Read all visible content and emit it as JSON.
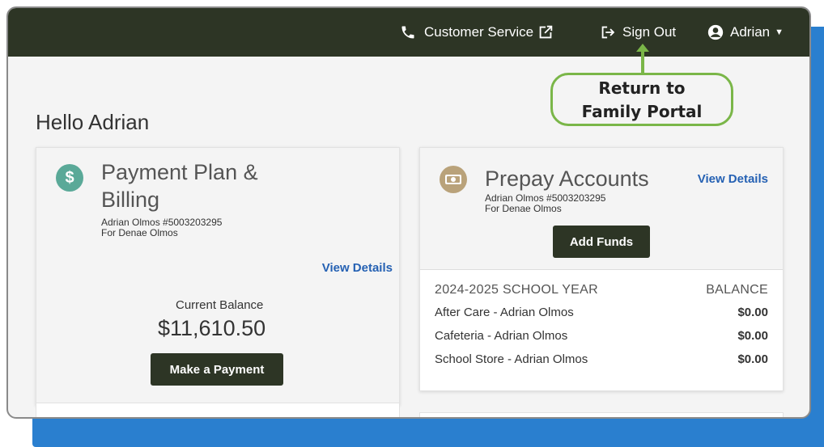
{
  "header": {
    "customer_service": "Customer Service",
    "sign_out": "Sign Out",
    "user": "Adrian"
  },
  "callout": {
    "line1": "Return to",
    "line2": "Family Portal"
  },
  "greeting": "Hello Adrian",
  "payment_card": {
    "icon_symbol": "$",
    "title_line1": "Payment Plan &",
    "title_line2": "Billing",
    "account": "Adrian Olmos #5003203295",
    "for": "For Denae Olmos",
    "view_details": "View Details",
    "balance_label": "Current Balance",
    "balance_value": "$11,610.50",
    "pay_button": "Make a Payment"
  },
  "prepay_card": {
    "title": "Prepay Accounts",
    "account": "Adrian Olmos #5003203295",
    "for": "For Denae Olmos",
    "view_details": "View Details",
    "add_funds": "Add Funds",
    "year_header": "2024-2025 SCHOOL YEAR",
    "balance_header": "BALANCE",
    "rows": [
      {
        "name": "After Care - Adrian Olmos",
        "amount": "$0.00"
      },
      {
        "name": "Cafeteria - Adrian Olmos",
        "amount": "$0.00"
      },
      {
        "name": "School Store - Adrian Olmos",
        "amount": "$0.00"
      }
    ]
  },
  "colors": {
    "topbar": "#2d3525",
    "accent_green": "#7ab648",
    "link_blue": "#2561b3",
    "backdrop_blue": "#2a7fcf"
  }
}
